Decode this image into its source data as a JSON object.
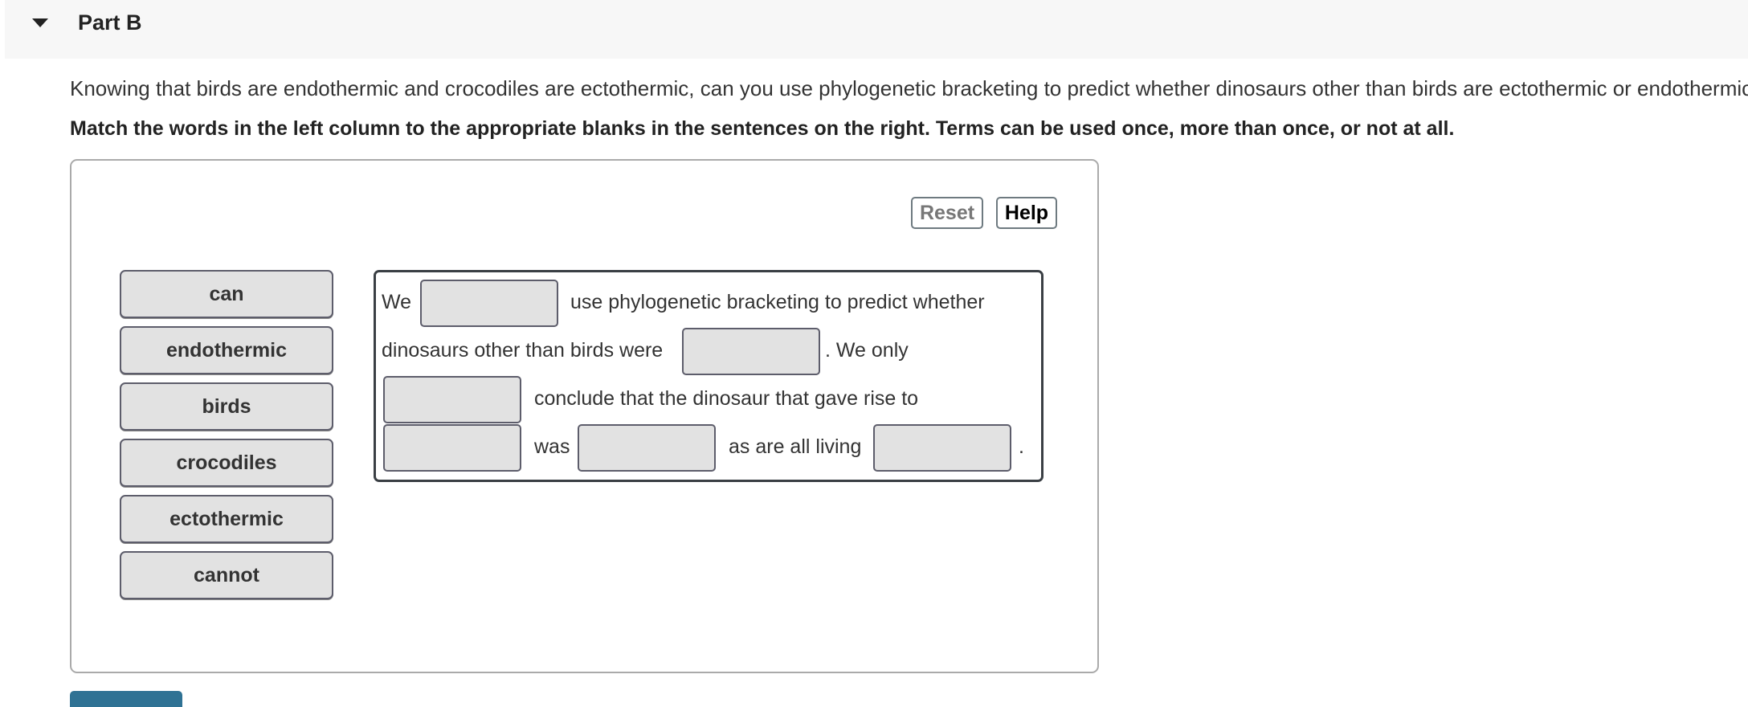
{
  "part": {
    "title": "Part B",
    "caret_icon": "triangle-down"
  },
  "question": "Knowing that birds are endothermic and crocodiles are ectothermic, can you use phylogenetic bracketing to predict whether dinosaurs other than birds are ectothermic or endothermic",
  "instruction": "Match the words in the left column to the appropriate blanks in the sentences on the right. Terms can be used once, more than once, or not at all.",
  "toolbar": {
    "reset_label": "Reset",
    "help_label": "Help"
  },
  "terms": [
    "can",
    "endothermic",
    "birds",
    "crocodiles",
    "ectothermic",
    "cannot"
  ],
  "sentence": {
    "seg1": "We",
    "seg2": "use phylogenetic bracketing to predict whether",
    "seg3": "dinosaurs other than birds were",
    "seg4": ". We only",
    "seg5": "conclude that the dinosaur that gave rise to",
    "seg6": "was",
    "seg7": "as are all living",
    "seg8": ".",
    "blanks": [
      "",
      "",
      "",
      "",
      "",
      ""
    ]
  },
  "colors": {
    "accent": "#2f7294",
    "chip_bg": "#e2e2e2",
    "header_bg": "#f7f7f7"
  }
}
